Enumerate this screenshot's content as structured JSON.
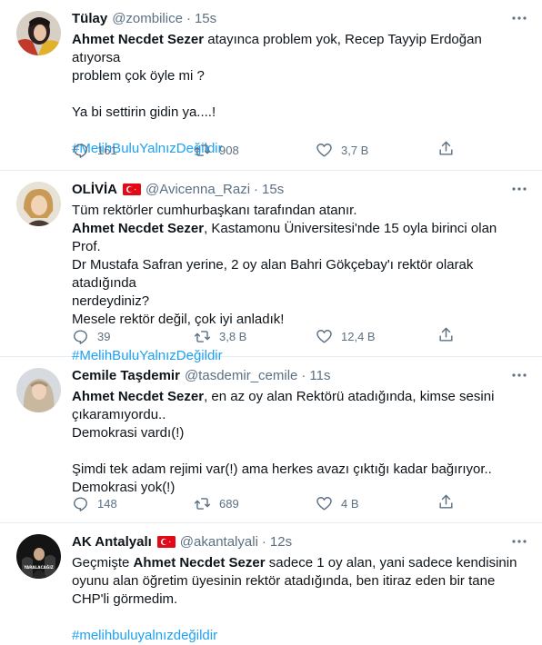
{
  "tweets": [
    {
      "name": "Tülay",
      "handle": "@zombilice",
      "time": "15s",
      "lines": [
        {
          "bold": "Ahmet Necdet Sezer",
          "text": " atayınca problem yok, Recep Tayyip Erdoğan atıyorsa"
        },
        {
          "text": "problem çok öyle mi ?"
        },
        {
          "text": ""
        },
        {
          "text": "Ya bi settirin gidin ya....!"
        },
        {
          "text": ""
        },
        {
          "hashtag": "#MelihBuluYalnızDeğildir"
        }
      ],
      "reply_count": "161",
      "retweet_count": "908",
      "like_count": "3,7 B"
    },
    {
      "name": "OLİVİA",
      "handle": "@Avicenna_Razi",
      "time": "15s",
      "lines": [
        {
          "text": "Tüm rektörler cumhurbaşkanı tarafından atanır."
        },
        {
          "bold": "Ahmet Necdet Sezer",
          "text": ", Kastamonu Üniversitesi'nde 15 oyla birinci olan Prof."
        },
        {
          "text": "Dr Mustafa Safran yerine, 2 oy alan Bahri Gökçebay'ı rektör olarak atadığında"
        },
        {
          "text": "nerdeydiniz?"
        },
        {
          "text": "Mesele rektör değil, çok iyi anladık!"
        },
        {
          "text": ""
        },
        {
          "hashtag": "#MelihBuluYalnızDeğildir"
        }
      ],
      "reply_count": "39",
      "retweet_count": "3,8 B",
      "like_count": "12,4 B"
    },
    {
      "name": "Cemile Taşdemir",
      "handle": "@tasdemir_cemile",
      "time": "11s",
      "lines": [
        {
          "bold": "Ahmet Necdet Sezer",
          "text": ", en az oy alan Rektörü atadığında, kimse sesini"
        },
        {
          "text": "çıkaramıyordu.."
        },
        {
          "text": "Demokrasi vardı(!)"
        },
        {
          "text": ""
        },
        {
          "text": "Şimdi tek adam rejimi var(!) ama herkes avazı çıktığı kadar bağırıyor.."
        },
        {
          "text": "Demokrasi yok(!)"
        }
      ],
      "reply_count": "148",
      "retweet_count": "689",
      "like_count": "4 B"
    },
    {
      "name": "AK Antalyalı",
      "handle": "@akantalyali",
      "time": "12s",
      "avatar_text": "YARALACAĞIZ",
      "lines": [
        {
          "pre": "Geçmişte ",
          "bold": "Ahmet Necdet Sezer",
          "text": " sadece  1 oy alan, yani sadece kendisinin"
        },
        {
          "text": "oyunu alan öğretim üyesinin rektör atadığında, ben itiraz eden bir tane"
        },
        {
          "text": "CHP'li görmedim."
        },
        {
          "text": ""
        },
        {
          "hashtag": "#melihbuluyalnızdeğildir"
        }
      ]
    }
  ],
  "colors": {
    "accent": "#1da1f2",
    "muted": "#5b7083",
    "flag": "#e30a17"
  },
  "icons": {
    "reply": "reply-icon",
    "retweet": "retweet-icon",
    "like": "heart-icon",
    "share": "share-icon",
    "more": "more-icon"
  }
}
